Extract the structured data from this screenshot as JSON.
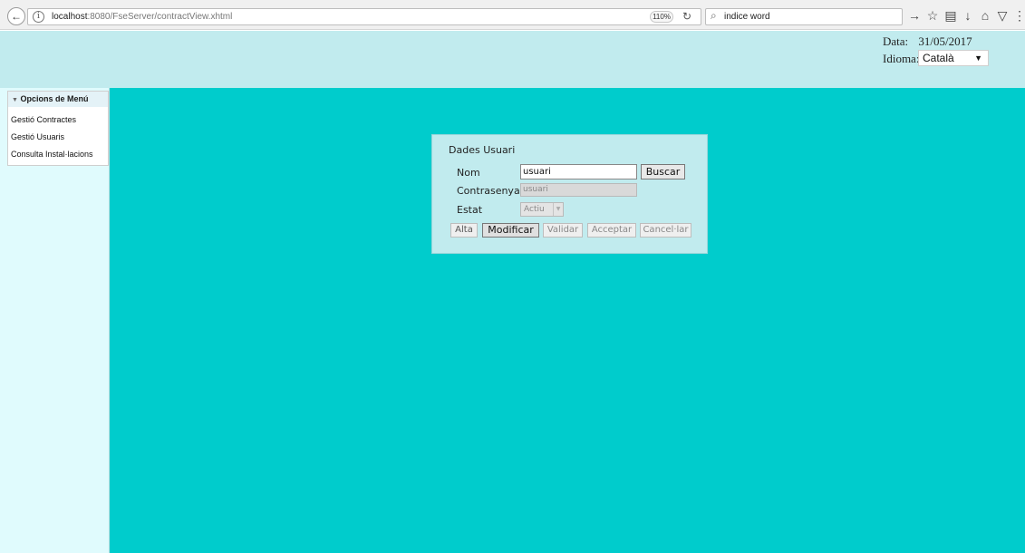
{
  "browser": {
    "url_host": "localhost",
    "url_rest": ":8080/FseServer/contractView.xhtml",
    "zoom": "110%",
    "search_text": "indice word"
  },
  "header": {
    "date_label": "Data:",
    "date_value": "31/05/2017",
    "language_label": "Idioma:",
    "language_value": "Català"
  },
  "sidebar": {
    "title": "Opcions de Menú",
    "items": [
      {
        "label": "Gestió Contractes"
      },
      {
        "label": "Gestió Usuaris"
      },
      {
        "label": "Consulta Instal·lacions"
      }
    ]
  },
  "dialog": {
    "title": "Dades Usuari",
    "nom_label": "Nom",
    "nom_value": "usuari",
    "search_button": "Buscar",
    "password_label": "Contrasenya",
    "password_value": "usuari",
    "status_label": "Estat",
    "status_value": "Actiu",
    "buttons": {
      "alta": "Alta",
      "modificar": "Modificar",
      "validar": "Validar",
      "acceptar": "Acceptar",
      "cancellar": "Cancel·lar"
    }
  }
}
